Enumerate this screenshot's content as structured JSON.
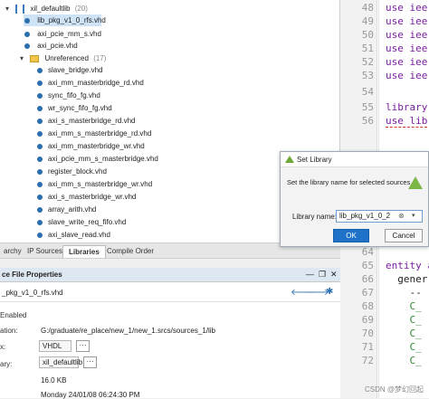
{
  "tree": {
    "header_label": "xil_defaultlib",
    "header_count": "(20)",
    "items": [
      {
        "label": "lib_pkg_v1_0_rfs.vhd",
        "selected": true
      },
      {
        "label": "axi_pcie_mm_s.vhd"
      },
      {
        "label": "axi_pcie.vhd"
      }
    ],
    "unreferenced_label": "Unreferenced",
    "unreferenced_count": "(17)",
    "unreferenced_items": [
      "slave_bridge.vhd",
      "axi_mm_masterbridge_rd.vhd",
      "sync_fifo_fg.vhd",
      "wr_sync_fifo_fg.vhd",
      "axi_s_masterbridge_rd.vhd",
      "axi_mm_s_masterbridge_rd.vhd",
      "axi_mm_masterbridge_wr.vhd",
      "axi_pcie_mm_s_masterbridge.vhd",
      "register_block.vhd",
      "axi_mm_s_masterbridge_wr.vhd",
      "axi_s_masterbridge_wr.vhd",
      "array_arith.vhd",
      "slave_write_req_fifo.vhd",
      "axi_slave_read.vhd"
    ]
  },
  "tabs": [
    {
      "label": "archy"
    },
    {
      "label": "IP Sources"
    },
    {
      "label": "Libraries",
      "active": true
    },
    {
      "label": "Compile Order"
    }
  ],
  "props": {
    "title": "ce File Properties",
    "file_name": "_pkg_v1_0_rfs.vhd",
    "enabled_label": "Enabled",
    "location_label": "ation:",
    "location_value": "G:/graduate/re_place/new_1/new_1.srcs/sources_1/lib",
    "type_label": "x:",
    "type_value": "VHDL",
    "library_label": "ary:",
    "library_value": "xil_defaultlib",
    "size_value": "16.0 KB",
    "modified_value": "Monday 24/01/08 06:24:30 PM",
    "ellipsis": "···"
  },
  "code": {
    "lines": [
      {
        "n": "48",
        "text": "use iee"
      },
      {
        "n": "49",
        "text": "use iee"
      },
      {
        "n": "50",
        "text": "use iee"
      },
      {
        "n": "51",
        "text": "use iee"
      },
      {
        "n": "52",
        "text": "use iee"
      },
      {
        "n": "53",
        "text": "use iee"
      },
      {
        "n": "54",
        "text": ""
      },
      {
        "n": "55",
        "text": "library"
      },
      {
        "n": "56",
        "text": "use lib"
      },
      {
        "n": "64",
        "text": ""
      },
      {
        "n": "65",
        "text": "entity a"
      },
      {
        "n": "66",
        "text": "  gener"
      },
      {
        "n": "67",
        "text": "    --"
      },
      {
        "n": "68",
        "text": "    C_"
      },
      {
        "n": "69",
        "text": "    C_"
      },
      {
        "n": "70",
        "text": "    C_"
      },
      {
        "n": "71",
        "text": "    C_"
      },
      {
        "n": "72",
        "text": "    C_"
      }
    ]
  },
  "dialog": {
    "title": "Set Library",
    "message": "Set the library name for selected sources.",
    "library_label": "Library name:",
    "library_value": "lib_pkg_v1_0_2",
    "ok_label": "OK",
    "cancel_label": "Cancel"
  },
  "watermark": "CSDN @梦幻回起"
}
